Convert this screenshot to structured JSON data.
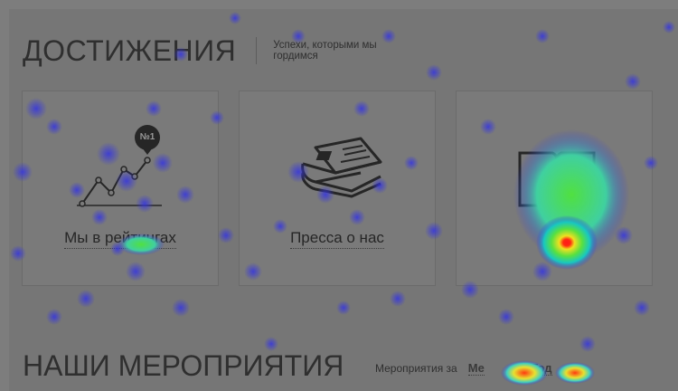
{
  "achievements": {
    "title": "ДОСТИЖЕНИЯ",
    "subtitle": "Успехи, которыми мы гордимся",
    "cards": [
      {
        "label": "Мы в рейтингах",
        "badge": "№1",
        "icon": "ranking-chart-icon"
      },
      {
        "label": "Пресса о нас",
        "icon": "newspaper-icon"
      },
      {
        "label": "",
        "icon": "book-icon"
      }
    ]
  },
  "events": {
    "title": "НАШИ МЕРОПРИЯТИЯ",
    "period_label": "Мероприятия за",
    "period_options": [
      "Ме",
      "Год"
    ]
  },
  "colors": {
    "overlay": "#767676",
    "text": "#2f2f2f",
    "heat_low": "#3b3bd6",
    "heat_mid": "#2fd15a",
    "heat_high": "#e01010"
  }
}
